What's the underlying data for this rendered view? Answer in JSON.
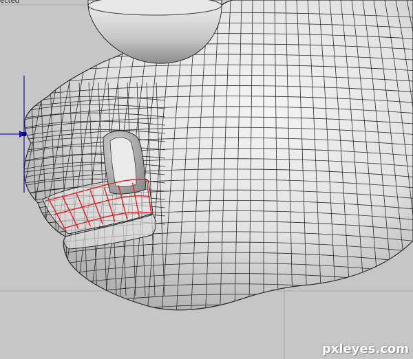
{
  "viewport": {
    "status_text": "ected",
    "background_color": "#c6c6c6",
    "grid_color": "#a9a9a9",
    "gizmo_color": "#1a1aa0",
    "selection_color": "#e02020",
    "wire_color": "#2a2a2a"
  },
  "scene": {
    "object": "character-head-mesh",
    "selected_edges": "lip-loop"
  },
  "watermark": "pxleyes.com"
}
